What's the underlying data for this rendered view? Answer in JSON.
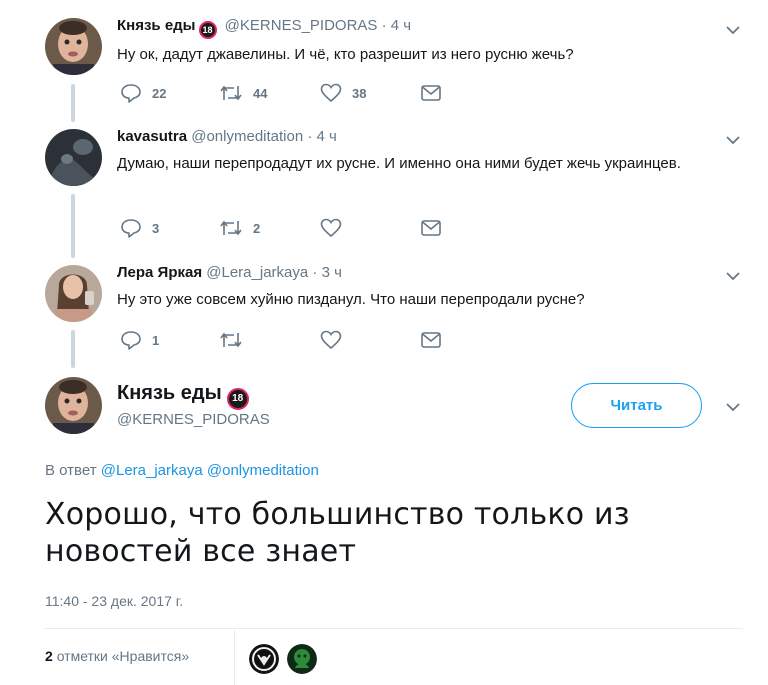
{
  "replies": [
    {
      "name": "Князь еды",
      "badge": "18",
      "handle": "@KERNES_PIDORAS",
      "time": "4 ч",
      "text": "Ну ок, дадут джавелины. И чё, кто разрешит из него русню жечь?",
      "replies_count": "22",
      "retweets_count": "44",
      "likes_count": "38"
    },
    {
      "name": "kavasutra",
      "badge": "",
      "handle": "@onlymeditation",
      "time": "4 ч",
      "text": "Думаю, наши перепродадут их русне. И именно она ними будет жечь украинцев.",
      "replies_count": "3",
      "retweets_count": "2",
      "likes_count": ""
    },
    {
      "name": "Лера Яркая",
      "badge": "",
      "handle": "@Lera_jarkaya",
      "time": "3 ч",
      "text": "Ну это уже совсем хуйню пизданул. Что наши перепродали русне?",
      "replies_count": "1",
      "retweets_count": "",
      "likes_count": ""
    }
  ],
  "separator": "·",
  "main": {
    "name": "Князь еды",
    "badge": "18",
    "handle": "@KERNES_PIDORAS",
    "follow_label": "Читать",
    "reply_prefix": "В ответ",
    "reply_to": [
      "@Lera_jarkaya",
      "@onlymeditation"
    ],
    "text": "Хорошо, что большинство только из новостей все знает",
    "timestamp": "11:40 - 23 дек. 2017 г.",
    "likes_count": "2",
    "likes_label": "отметки «Нравится»"
  },
  "icons": {
    "reply": "reply-icon",
    "retweet": "retweet-icon",
    "like": "heart-icon",
    "message": "envelope-icon",
    "more": "chevron-down-icon"
  },
  "colors": {
    "accent": "#1da1f2",
    "link": "#1b95e0",
    "secondary_text": "#657786",
    "thread_line": "#ccd6dd",
    "badge_ring": "#e0245e"
  }
}
